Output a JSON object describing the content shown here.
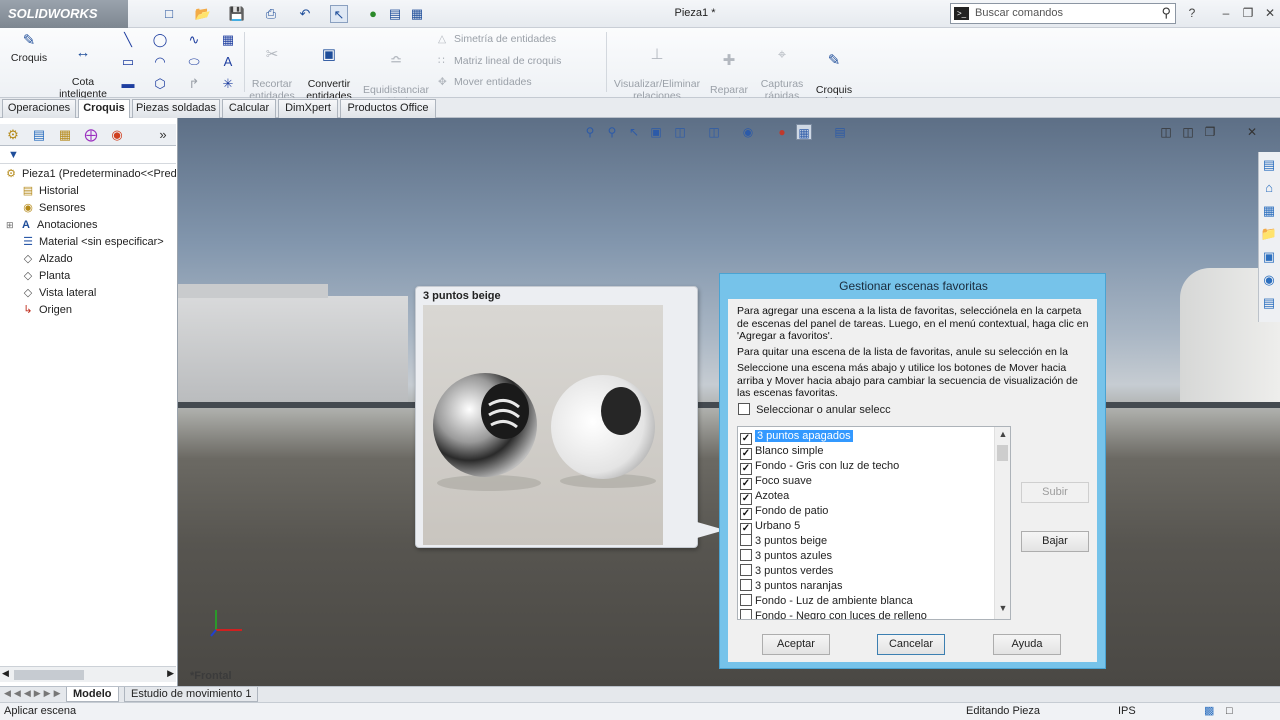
{
  "app": {
    "logo_text": "SOLIDWORKS",
    "document_title": "Pieza1 *"
  },
  "search": {
    "placeholder": "Buscar comandos"
  },
  "ribbon": {
    "croquis": "Croquis",
    "cota_inteligente": "Cota\ninteligente",
    "recortar": "Recortar\nentidades",
    "convertir": "Convertir\nentidades",
    "equidistanciar": "Equidistanciar\nentidades",
    "simetria": "Simetría de entidades",
    "matriz": "Matriz lineal de croquis",
    "mover": "Mover entidades",
    "visualizar": "Visualizar/Eliminar\nrelaciones",
    "reparar": "Reparar\ncroquis",
    "capturas": "Capturas\nrápidas",
    "croquis_rapido": "Croquis\nrápido"
  },
  "tabs": [
    "Operaciones",
    "Croquis",
    "Piezas soldadas",
    "Calcular",
    "DimXpert",
    "Productos Office"
  ],
  "tree": {
    "root": "Pieza1  (Predeterminado<<Pred",
    "items": [
      "Historial",
      "Sensores",
      "Anotaciones",
      "Material <sin especificar>",
      "Alzado",
      "Planta",
      "Vista lateral",
      "Origen"
    ]
  },
  "viewport": {
    "view_label": "*Frontal"
  },
  "preview": {
    "title": "3 puntos beige"
  },
  "dialog": {
    "title": "Gestionar escenas favoritas",
    "para1": "Para agregar una escena a la lista de favoritas, selecciónela en la carpeta de escenas del panel de tareas. Luego, en el menú contextual, haga clic en 'Agregar a favoritos'.",
    "para2": "Para quitar una escena de la lista de favoritas, anule su selección en la",
    "para3": "Seleccione una escena más abajo y utilice los botones de Mover hacia arriba y Mover hacia abajo para cambiar la secuencia de visualización de las escenas favoritas.",
    "select_all": "Seleccionar o anular selecc",
    "scenes": [
      {
        "label": "3 puntos apagados",
        "checked": true,
        "selected": true
      },
      {
        "label": "Blanco simple",
        "checked": true
      },
      {
        "label": "Fondo - Gris con luz de techo",
        "checked": true
      },
      {
        "label": "Foco suave",
        "checked": true
      },
      {
        "label": "Azotea",
        "checked": true
      },
      {
        "label": "Fondo de patio",
        "checked": true
      },
      {
        "label": "Urbano 5",
        "checked": true
      },
      {
        "label": "3 puntos beige",
        "checked": false
      },
      {
        "label": "3 puntos azules",
        "checked": false
      },
      {
        "label": "3 puntos verdes",
        "checked": false
      },
      {
        "label": "3 puntos naranjas",
        "checked": false
      },
      {
        "label": "Fondo - Luz de ambiente blanca",
        "checked": false
      },
      {
        "label": "Fondo - Negro con luces de relleno",
        "checked": false
      }
    ],
    "btn_subir": "Subir",
    "btn_bajar": "Bajar",
    "btn_aceptar": "Aceptar",
    "btn_cancelar": "Cancelar",
    "btn_ayuda": "Ayuda"
  },
  "bottom_tabs": [
    "Modelo",
    "Estudio de movimiento 1"
  ],
  "status": {
    "left": "Aplicar escena",
    "mode": "Editando Pieza",
    "units": "IPS"
  }
}
